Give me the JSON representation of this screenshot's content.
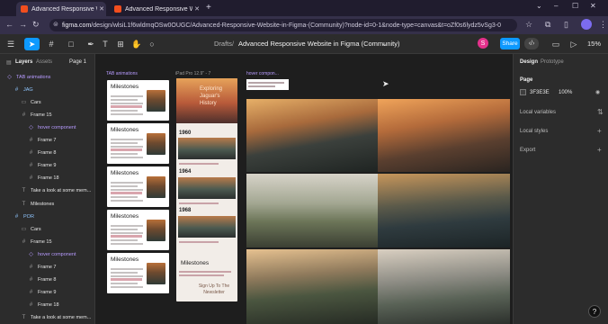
{
  "browser": {
    "tabs": [
      {
        "label": "Advanced Responsive Website",
        "active": true
      },
      {
        "label": "Advanced Responsive Website",
        "active": false
      }
    ],
    "new_tab": "+",
    "window_controls": [
      "⌄",
      "–",
      "☐",
      "✕"
    ],
    "url_host": "figma.com",
    "url_path": "/design/wlsiL1f6wldmqOSw0OUGC/Advanced-Responsive-Website-in-Figma-(Community)?node-id=0-1&node-type=canvas&t=oZf0s6lydz5vSg3-0"
  },
  "figma": {
    "crumb_team": "Drafts",
    "crumb_file": "Advanced Responsive Website in Figma (Community)",
    "avatar_letter": "S",
    "share_label": "Share",
    "zoom": "15%"
  },
  "left_panel": {
    "tabs": {
      "layers": "Layers",
      "assets": "Assets",
      "page": "Page 1"
    },
    "layers": [
      {
        "name": "TAB animations",
        "icon": "◇",
        "indent": 0,
        "style": "purple",
        "selected": false
      },
      {
        "name": "JAG",
        "icon": "#",
        "indent": 1,
        "style": "blue",
        "selected": false
      },
      {
        "name": "Cars",
        "icon": "▭",
        "indent": 2,
        "style": "normal",
        "selected": false
      },
      {
        "name": "Frame 15",
        "icon": "#",
        "indent": 2,
        "style": "normal",
        "selected": false
      },
      {
        "name": "hover component",
        "icon": "◇",
        "indent": 3,
        "style": "purple",
        "selected": false
      },
      {
        "name": "Frame 7",
        "icon": "#",
        "indent": 3,
        "style": "normal",
        "selected": false
      },
      {
        "name": "Frame 8",
        "icon": "#",
        "indent": 3,
        "style": "normal",
        "selected": false
      },
      {
        "name": "Frame 9",
        "icon": "#",
        "indent": 3,
        "style": "normal",
        "selected": false
      },
      {
        "name": "Frame 18",
        "icon": "#",
        "indent": 3,
        "style": "normal",
        "selected": false
      },
      {
        "name": "Take a look at some mem...",
        "icon": "T",
        "indent": 2,
        "style": "normal",
        "selected": false
      },
      {
        "name": "Milestones",
        "icon": "T",
        "indent": 2,
        "style": "normal",
        "selected": false
      },
      {
        "name": "POR",
        "icon": "#",
        "indent": 1,
        "style": "blue",
        "selected": false
      },
      {
        "name": "Cars",
        "icon": "▭",
        "indent": 2,
        "style": "normal",
        "selected": false
      },
      {
        "name": "Frame 15",
        "icon": "#",
        "indent": 2,
        "style": "normal",
        "selected": false
      },
      {
        "name": "hover component",
        "icon": "◇",
        "indent": 3,
        "style": "purple",
        "selected": false
      },
      {
        "name": "Frame 7",
        "icon": "#",
        "indent": 3,
        "style": "normal",
        "selected": false
      },
      {
        "name": "Frame 8",
        "icon": "#",
        "indent": 3,
        "style": "normal",
        "selected": false
      },
      {
        "name": "Frame 9",
        "icon": "#",
        "indent": 3,
        "style": "normal",
        "selected": false
      },
      {
        "name": "Frame 18",
        "icon": "#",
        "indent": 3,
        "style": "normal",
        "selected": false
      },
      {
        "name": "Take a look at some mem...",
        "icon": "T",
        "indent": 2,
        "style": "normal",
        "selected": false
      }
    ]
  },
  "canvas": {
    "frame_labels": {
      "tab_animations": "TAB animations",
      "ipad": "iPad Pro 12.9\" - 7",
      "hover": "hover compon..."
    },
    "milestone_cards": [
      {
        "title": "Milestones"
      },
      {
        "title": "Milestones"
      },
      {
        "title": "Milestones"
      },
      {
        "title": "Milestones"
      },
      {
        "title": "Milestones"
      }
    ],
    "tablet": {
      "hero_text": "Exploring Jaguar's History",
      "years": [
        "1960",
        "1964",
        "1968"
      ],
      "milestones": "Milestones",
      "signup": "Sign Up To The Newsletter"
    }
  },
  "right_panel": {
    "tabs": {
      "design": "Design",
      "prototype": "Prototype"
    },
    "page_heading": "Page",
    "page_color": "3F3E3E",
    "page_opacity": "100%",
    "local_variables": "Local variables",
    "local_styles": "Local styles",
    "export": "Export",
    "help": "?"
  },
  "colors": {
    "accent": "#0d99ff",
    "browser_bg": "#201c2e",
    "panel_bg": "#2c2c2c",
    "canvas_bg": "#1e1e1e"
  }
}
